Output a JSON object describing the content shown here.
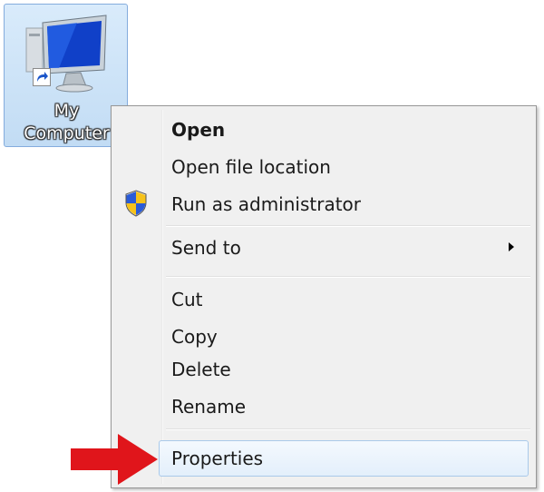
{
  "desktop_icon": {
    "label_line1": "My",
    "label_line2": "Computer",
    "icon": "computer-monitor-icon",
    "shortcut_icon": "shortcut-arrow-icon"
  },
  "context_menu": {
    "items": [
      {
        "label": "Open",
        "bold": true
      },
      {
        "label": "Open file location"
      },
      {
        "label": "Run as administrator",
        "icon": "uac-shield-icon"
      },
      {
        "label": "Send to",
        "submenu_icon": "submenu-arrow-icon"
      },
      {
        "label": "Cut"
      },
      {
        "label": "Copy"
      },
      {
        "label": "Delete"
      },
      {
        "label": "Rename"
      },
      {
        "label": "Properties",
        "highlighted": true
      }
    ]
  },
  "annotation": {
    "icon": "red-pointer-arrow-icon",
    "color": "#e0151b"
  },
  "colors": {
    "menu_background": "#f0f0f0",
    "selection_blue": "#d9ebfb"
  }
}
